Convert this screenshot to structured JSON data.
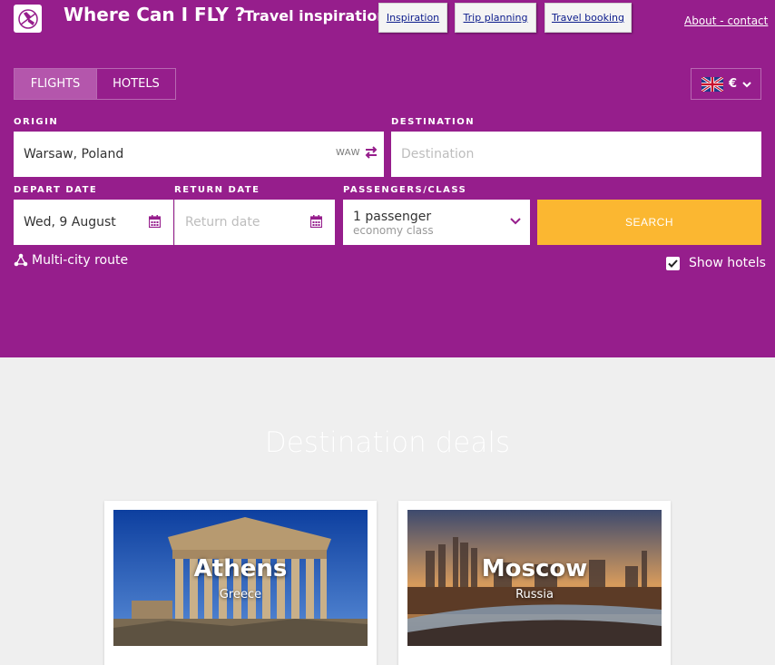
{
  "header": {
    "site_title": "Where Can I FLY ?",
    "tagline": "Travel inspiration",
    "nav": [
      {
        "label": "Inspiration"
      },
      {
        "label": "Trip planning"
      },
      {
        "label": "Travel booking"
      }
    ],
    "about_link": "About - contact",
    "logo_icon": "plane-globe-icon"
  },
  "tabs": [
    {
      "label": "FLIGHTS",
      "active": true
    },
    {
      "label": "HOTELS",
      "active": false
    }
  ],
  "language": {
    "flag_icon": "uk-flag-icon",
    "currency": "€"
  },
  "form": {
    "origin_label": "ORIGIN",
    "origin_value": "Warsaw, Poland",
    "origin_code": "WAW",
    "destination_label": "DESTINATION",
    "destination_placeholder": "Destination",
    "depart_label": "DEPART DATE",
    "depart_value": "Wed, 9 August",
    "return_label": "RETURN DATE",
    "return_placeholder": "Return date",
    "passengers_label": "PASSENGERS/CLASS",
    "passengers_value": "1 passenger",
    "class_value": "economy class",
    "search_label": "SEARCH",
    "multi_city": "Multi-city route",
    "show_hotels": "Show hotels",
    "show_hotels_checked": true
  },
  "deals": {
    "title": "Destination deals",
    "cards": [
      {
        "city": "Athens",
        "country": "Greece"
      },
      {
        "city": "Moscow",
        "country": "Russia"
      }
    ]
  },
  "colors": {
    "brand_purple": "#961e8c",
    "search_orange": "#fbb731",
    "page_bg": "#efefef"
  }
}
